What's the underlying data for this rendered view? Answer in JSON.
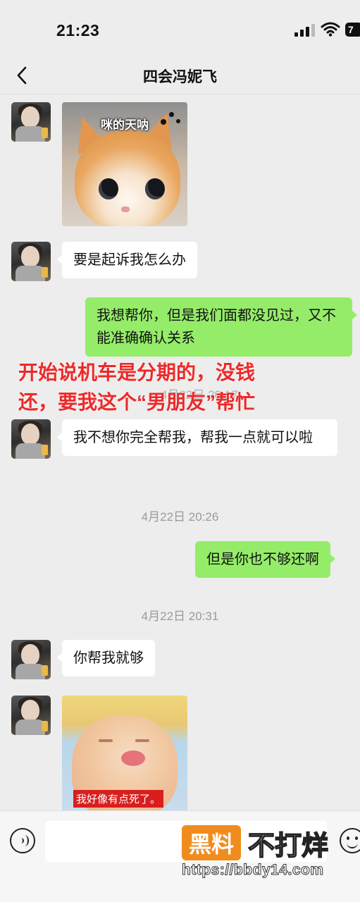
{
  "status_bar": {
    "time": "21:23",
    "battery": "7"
  },
  "nav": {
    "title": "四会冯妮飞",
    "back_icon": "chevron-left-icon"
  },
  "messages": [
    {
      "type": "sticker",
      "side": "in",
      "caption": "咪的天呐"
    },
    {
      "type": "text",
      "side": "in",
      "text": "要是起诉我怎么办"
    },
    {
      "type": "text",
      "side": "out",
      "text": "我想帮你，但是我们面都没见过，又不能准确确认关系"
    },
    {
      "type": "timestamp",
      "text": "4月22日 20:17"
    },
    {
      "type": "text",
      "side": "in",
      "text": "我不想你完全帮我，帮我一点就可以啦"
    },
    {
      "type": "timestamp",
      "text": "4月22日 20:26"
    },
    {
      "type": "text",
      "side": "out",
      "text": "但是你也不够还啊"
    },
    {
      "type": "timestamp",
      "text": "4月22日 20:31"
    },
    {
      "type": "text",
      "side": "in",
      "text": "你帮我就够"
    },
    {
      "type": "sticker",
      "side": "in",
      "caption": "我好像有点死了。"
    }
  ],
  "annotation": {
    "line1": "开始说机车是分期的，没钱",
    "line2": "还，要我这个“男朋友”帮忙"
  },
  "input_bar": {
    "voice_icon": "voice-icon",
    "emoji_icon": "emoji-icon"
  },
  "watermark": {
    "badge": "黑料",
    "text": "不打烊",
    "url": "https://bbdy14.com"
  },
  "colors": {
    "background": "#ededed",
    "incoming_bubble": "#ffffff",
    "outgoing_bubble": "#95ec69",
    "annotation": "#ec2a2a",
    "watermark_badge": "#f08c1e"
  }
}
